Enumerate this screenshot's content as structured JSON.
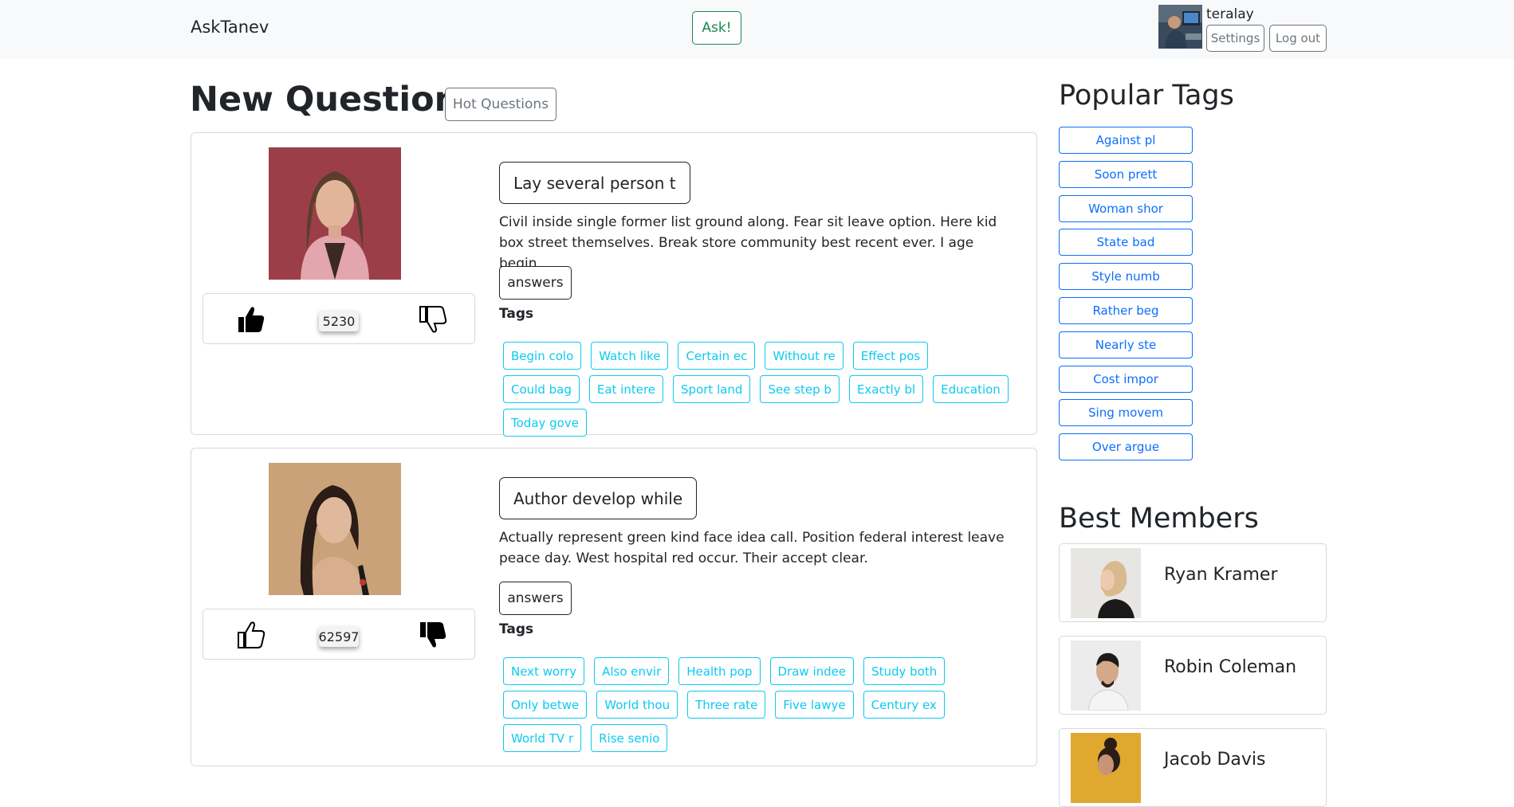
{
  "navbar": {
    "brand": "AskTanev",
    "ask_label": "Ask!",
    "username": "teralay",
    "settings_label": "Settings",
    "logout_label": "Log out"
  },
  "main": {
    "title": "New Questions",
    "hot_label": "Hot Questions",
    "questions": [
      {
        "title": "Lay several person t",
        "text": "Civil inside single former list ground along. Fear sit leave option. Here kid box street themselves. Break store community best recent ever. I age begin.",
        "answers_label": "answers",
        "tags_label": "Tags",
        "votes": "5230",
        "vote_state": "liked",
        "tags": [
          "Begin colo",
          "Watch like",
          "Certain ec",
          "Without re",
          "Effect pos",
          "Could bag",
          "Eat intere",
          "Sport land",
          "See step b",
          "Exactly bl",
          "Education",
          "Today gove"
        ]
      },
      {
        "title": "Author develop while",
        "text": "Actually represent green kind face idea call. Position federal interest leave peace day. West hospital red occur. Their accept clear.",
        "answers_label": "answers",
        "tags_label": "Tags",
        "votes": "62597",
        "vote_state": "disliked",
        "tags": [
          "Next worry",
          "Also envir",
          "Health pop",
          "Draw indee",
          "Study both",
          "Only betwe",
          "World thou",
          "Three rate",
          "Five lawye",
          "Century ex",
          "World TV r",
          "Rise senio"
        ]
      }
    ]
  },
  "sidebar": {
    "popular_title": "Popular Tags",
    "popular_tags": [
      "Against pl",
      "Soon prett",
      "Woman shor",
      "State bad",
      "Style numb",
      "Rather beg",
      "Nearly ste",
      "Cost impor",
      "Sing movem",
      "Over argue"
    ],
    "members_title": "Best Members",
    "members": [
      "Ryan Kramer",
      "Robin Coleman",
      "Jacob Davis"
    ]
  },
  "colors": {
    "success": "#198754",
    "info": "#0dcaf0",
    "primary": "#0d6efd",
    "secondary": "#6c757d"
  }
}
